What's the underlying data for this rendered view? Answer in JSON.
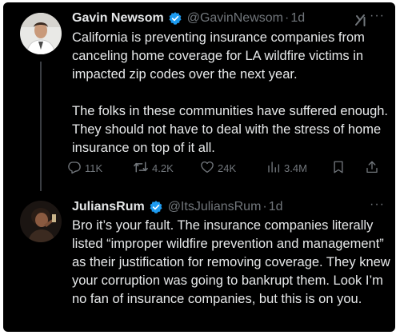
{
  "tweet1": {
    "name": "Gavin Newsom",
    "handle": "@GavinNewsom",
    "separator": "·",
    "time": "1d",
    "text": "California is preventing insurance companies from canceling home coverage for LA wildfire victims in impacted zip codes over the next year.\n\nThe folks in these communities have suffered enough. They should not have to deal with the stress of home insurance on top of it all.",
    "more": "···",
    "stats": {
      "replies": "11K",
      "reposts": "4.2K",
      "likes": "24K",
      "views": "3.4M"
    }
  },
  "tweet2": {
    "name": "JuliansRum",
    "handle": "@ItsJuliansRum",
    "separator": "·",
    "time": "1d",
    "text": "Bro it’s your fault. The insurance companies literally listed “improper wildfire prevention and management” as their justification for removing coverage. They knew your corruption was going to bankrupt them. Look I’m no fan of insurance companies, but this is on you.",
    "more": "···"
  },
  "colors": {
    "background": "#000000",
    "text": "#e7e9ea",
    "muted": "#71767b",
    "verified": "#1d9bf0"
  },
  "icons": [
    "verified-badge-icon",
    "grok-icon",
    "more-icon",
    "reply-icon",
    "repost-icon",
    "like-icon",
    "views-icon",
    "bookmark-icon",
    "share-icon"
  ]
}
